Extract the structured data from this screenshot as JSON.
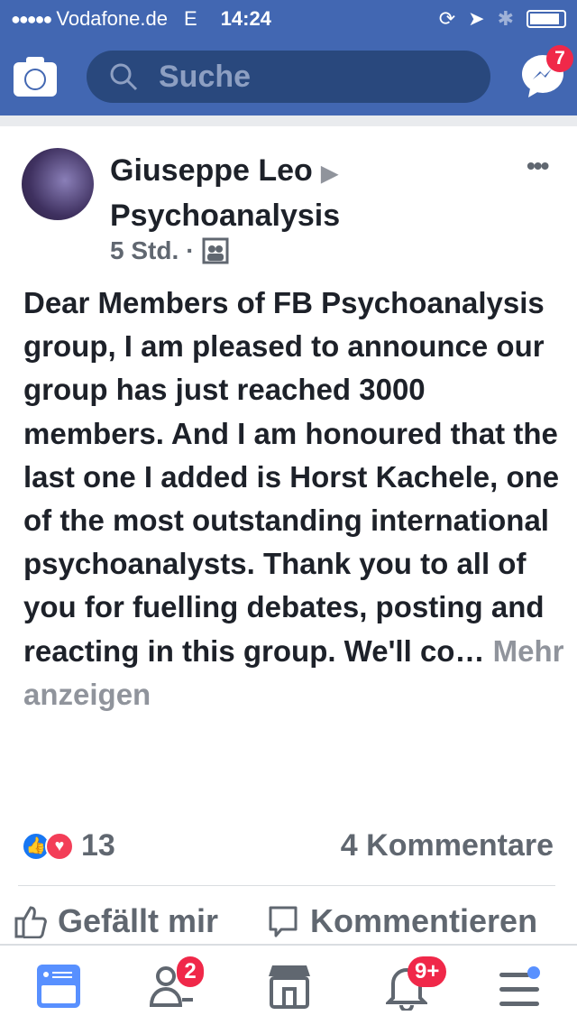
{
  "status_bar": {
    "carrier": "Vodafone.de",
    "network": "E",
    "time": "14:24"
  },
  "header": {
    "search_placeholder": "Suche",
    "messenger_badge": "7",
    "brand_color": "#4267b2"
  },
  "post": {
    "author": "Giuseppe Leo",
    "group": "Psychoanalysis",
    "time": "5 Std.",
    "separator": "·",
    "audience_icon": "group-icon",
    "text": "Dear Members of FB Psychoanalysis group, I am pleased to announce our group has just reached 3000 members. And I am honoured that the last one I added is Horst Kachele, one of the most outstanding international psychoanalysts. Thank you to all of you for fuelling debates, posting and reacting in this group. We'll co…",
    "more_label": "Mehr anzeigen",
    "reaction_count": "13",
    "comments_label": "4 Kommentare",
    "like_label": "Gefällt mir",
    "comment_label": "Kommentieren"
  },
  "nav": {
    "friends_badge": "2",
    "notifications_badge": "9+"
  }
}
